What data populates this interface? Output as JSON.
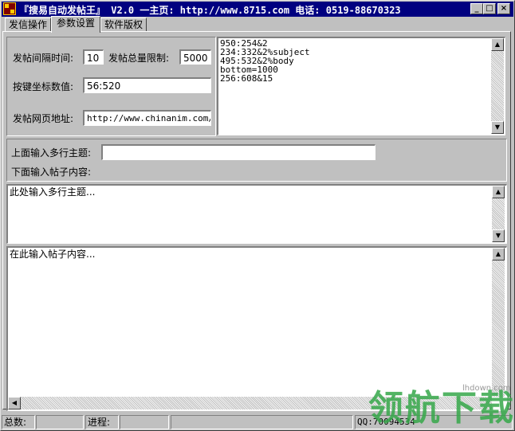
{
  "window": {
    "title": "『搜易自动发帖王』 V2.0  一主页: http://www.8715.com 电话: 0519-88670323",
    "minimize": "_",
    "maximize": "□",
    "close": "×"
  },
  "tabs": [
    {
      "label": "发信操作",
      "active": false
    },
    {
      "label": "参数设置",
      "active": true
    },
    {
      "label": "软件版权",
      "active": false
    }
  ],
  "settings": {
    "interval_label": "发帖间隔时间:",
    "interval_value": "10",
    "total_label": "发帖总量限制:",
    "total_value": "5000",
    "coords_label": "按键坐标数值:",
    "coords_value": "56:520",
    "url_label": "发帖网页地址:",
    "url_value": "http://www.chinanim.com/b"
  },
  "coords_list": "950:254&2\n234:332&2%subject\n495:532&2%body\nbottom=1000\n256:608&15",
  "topic": {
    "label": "上面输入多行主题:",
    "value": "",
    "content_label": "下面输入帖子内容:"
  },
  "topics_area": "此处输入多行主题...",
  "content_area": "在此输入帖子内容...",
  "status": {
    "total_label": "总数:",
    "total_value": "",
    "progress_label": "进程:",
    "progress_value": "",
    "qq": "QQ:70094534"
  },
  "watermark": {
    "url": "lhdown.com",
    "logo": "领航下载"
  },
  "icons": {
    "up": "▲",
    "down": "▼",
    "left": "◀",
    "right": "▶"
  },
  "colors": {
    "titlebar": "#000080",
    "face": "#c0c0c0",
    "field": "#ffffff",
    "watermark": "#36a84a"
  }
}
